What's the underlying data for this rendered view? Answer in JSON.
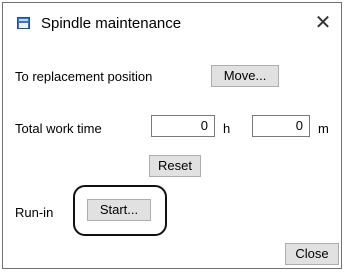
{
  "window": {
    "title": "Spindle maintenance",
    "icon": "window-app-icon",
    "close_glyph": "✕"
  },
  "replacement": {
    "label": "To replacement position",
    "move_button": "Move..."
  },
  "work_time": {
    "label": "Total work time",
    "hours_value": "0",
    "hours_unit": "h",
    "minutes_value": "0",
    "minutes_unit": "m"
  },
  "reset_button": "Reset",
  "run_in": {
    "label": "Run-in",
    "start_button": "Start..."
  },
  "close_button": "Close",
  "colors": {
    "button_face": "#e1e1e1",
    "button_border": "#adadad",
    "highlight_ring": "#111111"
  }
}
